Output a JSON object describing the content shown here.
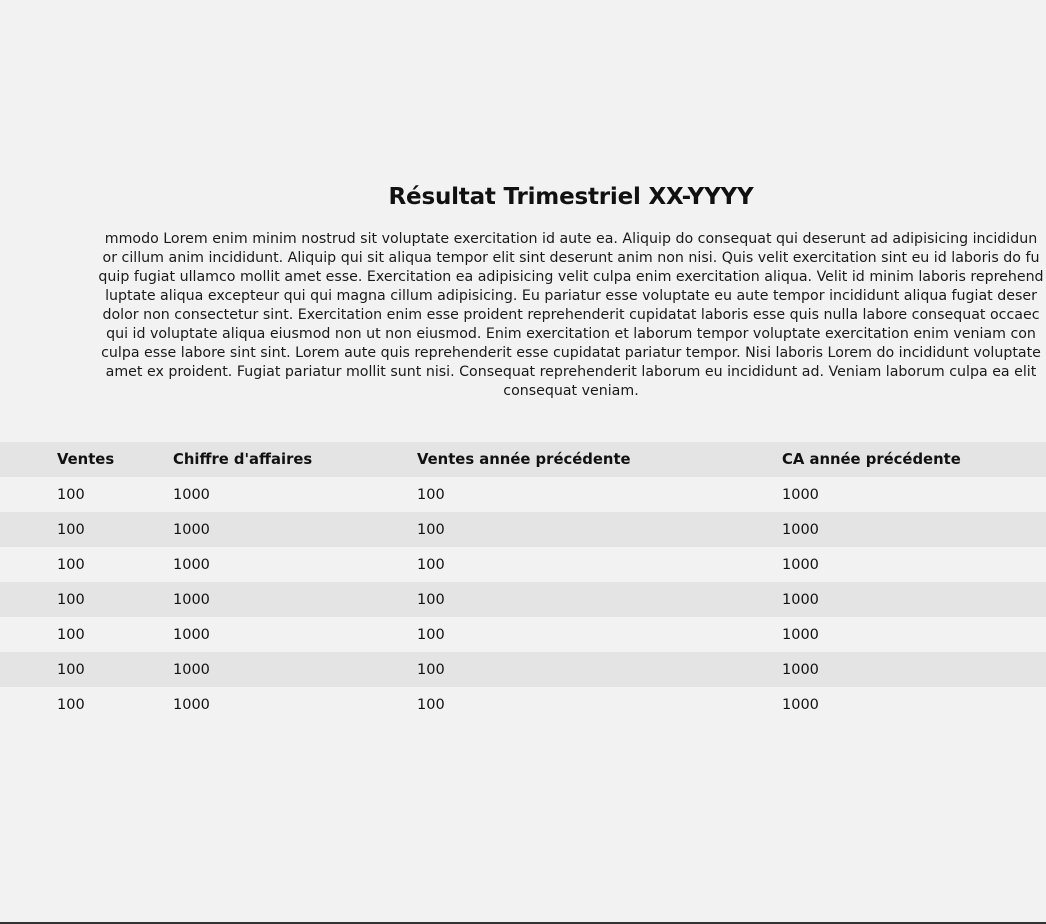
{
  "page": {
    "title": "Résultat Trimestriel XX-YYYY",
    "intro_lines": [
      "mmodo Lorem enim minim nostrud sit voluptate exercitation id aute ea. Aliquip do consequat qui deserunt ad adipisicing incididun",
      "or cillum anim incididunt. Aliquip qui sit aliqua tempor elit sint deserunt anim non nisi. Quis velit exercitation sint eu id laboris do fu",
      "quip fugiat ullamco mollit amet esse. Exercitation ea adipisicing velit culpa enim exercitation aliqua. Velit id minim laboris reprehend",
      "luptate aliqua excepteur qui qui magna cillum adipisicing. Eu pariatur esse voluptate eu aute tempor incididunt aliqua fugiat deser",
      "dolor non consectetur sint. Exercitation enim esse proident reprehenderit cupidatat laboris esse quis nulla labore consequat occaec",
      "qui id voluptate aliqua eiusmod non ut non eiusmod. Enim exercitation et laborum tempor voluptate exercitation enim veniam con",
      "culpa esse labore sint sint. Lorem aute quis reprehenderit esse cupidatat pariatur tempor. Nisi laboris Lorem do incididunt voluptate",
      "amet ex proident. Fugiat pariatur mollit sunt nisi. Consequat reprehenderit laborum eu incididunt ad. Veniam laborum culpa ea elit",
      "consequat veniam."
    ]
  },
  "table": {
    "headers": [
      "",
      "Ventes",
      "Chiffre d'affaires",
      "Ventes année précédente",
      "CA année précédente"
    ],
    "rows": [
      [
        "",
        "100",
        "1000",
        "100",
        "1000"
      ],
      [
        "",
        "100",
        "1000",
        "100",
        "1000"
      ],
      [
        "",
        "100",
        "1000",
        "100",
        "1000"
      ],
      [
        "",
        "100",
        "1000",
        "100",
        "1000"
      ],
      [
        "",
        "100",
        "1000",
        "100",
        "1000"
      ],
      [
        "",
        "100",
        "1000",
        "100",
        "1000"
      ],
      [
        "",
        "100",
        "1000",
        "100",
        "1000"
      ]
    ]
  }
}
